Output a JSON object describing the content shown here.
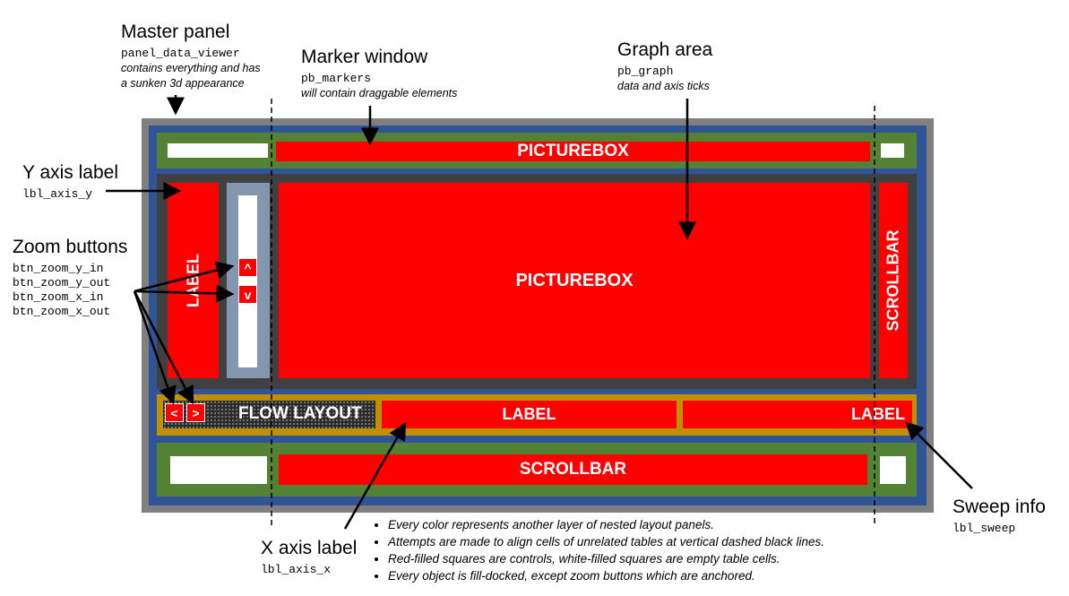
{
  "callouts": {
    "master_panel": {
      "title": "Master panel",
      "code": "panel_data_viewer",
      "desc1": "contains everything and has",
      "desc2": "a sunken 3d appearance"
    },
    "marker_window": {
      "title": "Marker window",
      "code": "pb_markers",
      "desc": "will contain draggable elements"
    },
    "graph_area": {
      "title": "Graph area",
      "code": "pb_graph",
      "desc": "data and axis ticks"
    },
    "y_axis_label": {
      "title": "Y axis label",
      "code": "lbl_axis_y"
    },
    "zoom_buttons": {
      "title": "Zoom buttons",
      "codes": [
        "btn_zoom_y_in",
        "btn_zoom_y_out",
        "btn_zoom_x_in",
        "btn_zoom_x_out"
      ]
    },
    "x_axis_label": {
      "title": "X axis label",
      "code": "lbl_axis_x"
    },
    "sweep_info": {
      "title": "Sweep info",
      "code": "lbl_sweep"
    }
  },
  "diagram": {
    "top_picturebox": "PICTUREBOX",
    "y_label": "LABEL",
    "zoom_y_in": "^",
    "zoom_y_out": "v",
    "main_picturebox": "PICTUREBOX",
    "right_scrollbar": "SCROLLBAR",
    "zoom_x_left": "<",
    "zoom_x_right": ">",
    "flow_layout": "FLOW LAYOUT",
    "x_label": "LABEL",
    "sweep_label": "LABEL",
    "bottom_scrollbar": "SCROLLBAR"
  },
  "colors": {
    "master": "#808080",
    "outer_blue": "#2f5597",
    "green": "#548235",
    "dark": "#404040",
    "gold": "#bf9000",
    "scroll_track": "#8497b0",
    "control": "#ff0000",
    "empty_cell": "#ffffff"
  },
  "notes": [
    "Every color represents another layer of nested layout panels.",
    "Attempts are made to align cells of unrelated tables at vertical dashed black lines.",
    "Red-filled squares are controls, white-filled squares are empty table cells.",
    "Every object is fill-docked, except zoom buttons which are anchored."
  ]
}
